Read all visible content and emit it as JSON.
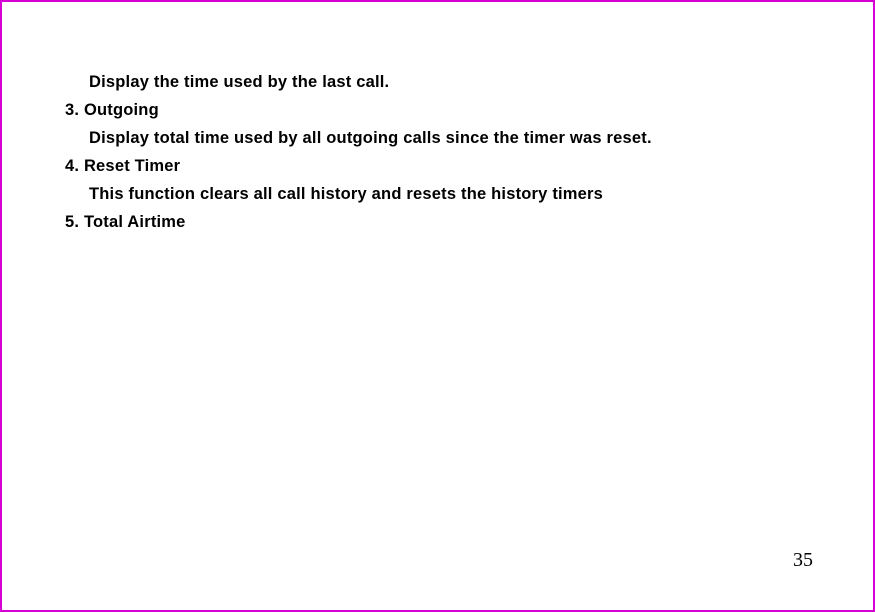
{
  "content": {
    "line1": "Display the time used by the last call.",
    "line2": "3. Outgoing",
    "line3": "Display total time used by all outgoing calls since the timer was reset.",
    "line4": "4. Reset Timer",
    "line5": "This function clears all call history and resets the history timers",
    "line6": "5. Total Airtime"
  },
  "page_number": "35"
}
